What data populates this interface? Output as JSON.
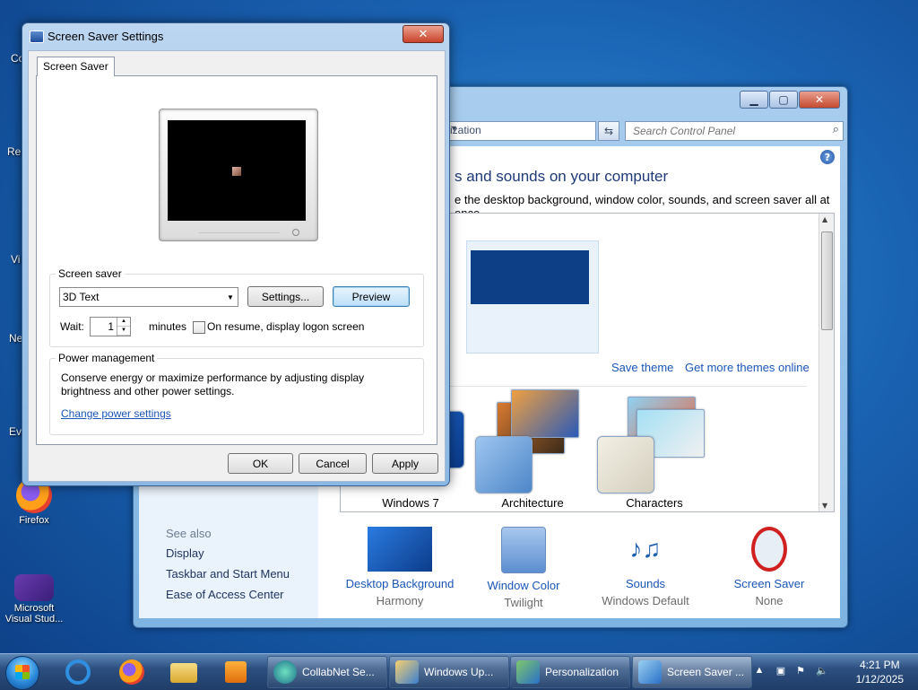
{
  "desktop": {
    "icons": [
      {
        "label": "Firefox"
      },
      {
        "label": "Microsoft Visual Stud..."
      }
    ],
    "partial_labels": [
      "Co",
      "Re",
      "Vi",
      "Ne",
      "Ev"
    ]
  },
  "control_panel": {
    "address_text": "ization",
    "search_placeholder": "Search Control Panel",
    "heading": "s and sounds on your computer",
    "subtext": "e the desktop background, window color, sounds, and screen saver all at once.",
    "save_theme": "Save theme",
    "get_more_themes": "Get more themes online",
    "themes": [
      {
        "label": "Windows 7"
      },
      {
        "label": "Architecture"
      },
      {
        "label": "Characters"
      }
    ],
    "see_also": {
      "title": "See also",
      "items": [
        "Display",
        "Taskbar and Start Menu",
        "Ease of Access Center"
      ]
    },
    "bottom_items": [
      {
        "label": "Desktop Background",
        "sub": "Harmony"
      },
      {
        "label": "Window Color",
        "sub": "Twilight"
      },
      {
        "label": "Sounds",
        "sub": "Windows Default"
      },
      {
        "label": "Screen Saver",
        "sub": "None"
      }
    ]
  },
  "screen_saver_dialog": {
    "title": "Screen Saver Settings",
    "tab": "Screen Saver",
    "screensaver_group": "Screen saver",
    "selected_screensaver": "3D Text",
    "settings_button": "Settings...",
    "preview_button": "Preview",
    "wait_label": "Wait:",
    "wait_value": "1",
    "minutes_label": "minutes",
    "resume_checkbox_label": "On resume, display logon screen",
    "power_group": "Power management",
    "power_text": "Conserve energy or maximize performance by adjusting display brightness and other power settings.",
    "power_link": "Change power settings",
    "ok_button": "OK",
    "cancel_button": "Cancel",
    "apply_button": "Apply"
  },
  "taskbar": {
    "tasks": [
      {
        "label": "CollabNet Se..."
      },
      {
        "label": "Windows Up..."
      },
      {
        "label": "Personalization"
      },
      {
        "label": "Screen Saver ..."
      }
    ],
    "time": "4:21 PM",
    "date": "1/12/2025"
  }
}
